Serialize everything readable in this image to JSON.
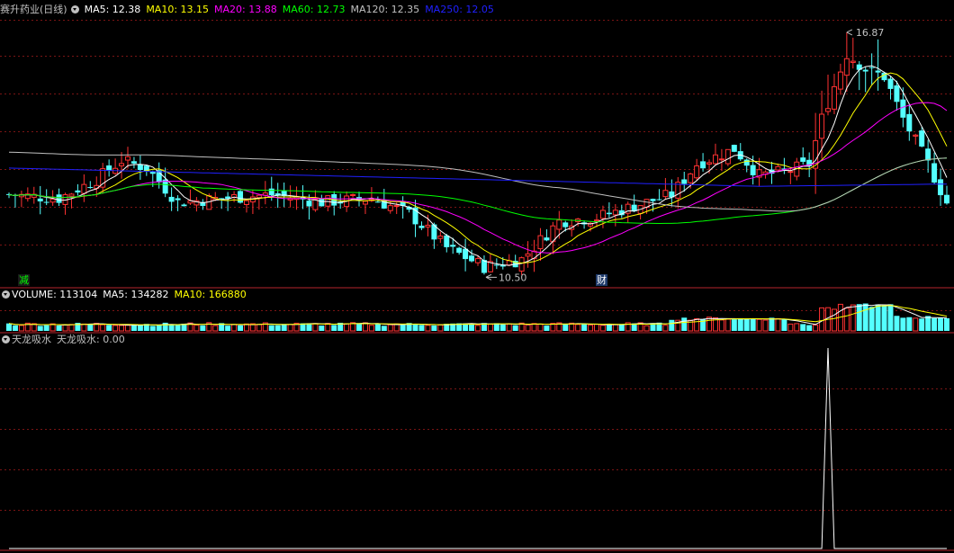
{
  "price_header": {
    "name": "赛升药业(日线)",
    "indicators": [
      {
        "label": "MA5: 12.38",
        "color": "#ffffff"
      },
      {
        "label": "MA10: 13.15",
        "color": "#ffff00"
      },
      {
        "label": "MA20: 13.88",
        "color": "#ff00ff"
      },
      {
        "label": "MA60: 12.73",
        "color": "#00ff00"
      },
      {
        "label": "MA120: 12.35",
        "color": "#c0c0c0"
      },
      {
        "label": "MA250: 12.05",
        "color": "#2020ff"
      }
    ]
  },
  "volume_header": {
    "indicators": [
      {
        "label": "VOLUME: 113104",
        "color": "#ffffff"
      },
      {
        "label": "MA5: 134282",
        "color": "#ffffff"
      },
      {
        "label": "MA10: 166880",
        "color": "#ffff00"
      }
    ]
  },
  "indicator_header": {
    "name": "天龙吸水",
    "value_label": "天龙吸水: 0.00"
  },
  "annotations": {
    "high_label": "16.87",
    "low_label": "10.50",
    "tag_reduce": "减",
    "tag_finance": "财"
  },
  "colors": {
    "up": "#ff3232",
    "down": "#54ffff",
    "grid": "#7a1414",
    "border": "#b4252b",
    "ma5": "#ffffff",
    "ma10": "#ffff00",
    "ma20": "#ff00ff",
    "ma60": "#00ff00",
    "ma120": "#c0c0c0",
    "ma250": "#2020ff"
  },
  "chart_data": [
    {
      "type": "candlestick",
      "title": "赛升药业(日线)",
      "x_count": 151,
      "ylim": [
        10.2,
        17.2
      ],
      "grid": true,
      "high": {
        "index": 134,
        "value": 16.87
      },
      "low": {
        "index": 76,
        "value": 10.5
      },
      "last_close": 12.38,
      "series": [
        {
          "name": "MA5",
          "last": 12.38
        },
        {
          "name": "MA10",
          "last": 13.15
        },
        {
          "name": "MA20",
          "last": 13.88
        },
        {
          "name": "MA60",
          "last": 12.73
        },
        {
          "name": "MA120",
          "last": 12.35
        },
        {
          "name": "MA250",
          "last": 12.05
        }
      ]
    },
    {
      "type": "bar",
      "title": "VOLUME",
      "last": 113104,
      "series": [
        {
          "name": "MA5",
          "last": 134282
        },
        {
          "name": "MA10",
          "last": 166880
        }
      ]
    },
    {
      "type": "line",
      "title": "天龙吸水",
      "last": 0.0,
      "x_count": 151,
      "ylim": [
        0,
        1
      ],
      "spike": {
        "index": 131,
        "value": 1
      }
    }
  ]
}
